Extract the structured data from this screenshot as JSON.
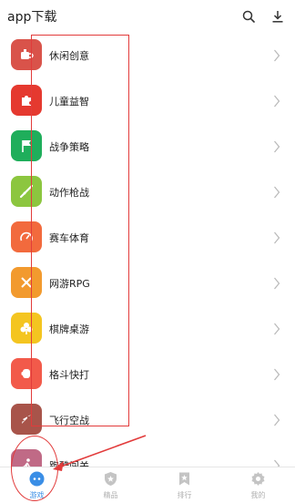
{
  "header": {
    "title": "app下载",
    "search_icon": "search-icon",
    "download_icon": "download-icon"
  },
  "categories": [
    {
      "label": "休闲创意",
      "icon": "puzzle-cup-icon",
      "color": "#d9534a"
    },
    {
      "label": "儿童益智",
      "icon": "puzzle-piece-icon",
      "color": "#e5392f"
    },
    {
      "label": "战争策略",
      "icon": "flag-icon",
      "color": "#1fae5b"
    },
    {
      "label": "动作枪战",
      "icon": "rifle-icon",
      "color": "#8cc63f"
    },
    {
      "label": "赛车体育",
      "icon": "speedometer-icon",
      "color": "#f26a3d"
    },
    {
      "label": "网游RPG",
      "icon": "crossed-swords-icon",
      "color": "#f29a2e"
    },
    {
      "label": "棋牌桌游",
      "icon": "club-card-icon",
      "color": "#f4c520"
    },
    {
      "label": "格斗快打",
      "icon": "fist-icon",
      "color": "#f25a4a"
    },
    {
      "label": "飞行空战",
      "icon": "rocket-icon",
      "color": "#a8544a"
    },
    {
      "label": "跑酷闯关",
      "icon": "runner-icon",
      "color": "#c06a86"
    }
  ],
  "tabbar": {
    "tabs": [
      {
        "label": "游戏",
        "icon": "gamepad-icon",
        "active": true
      },
      {
        "label": "精品",
        "icon": "shield-star-icon",
        "active": false
      },
      {
        "label": "排行",
        "icon": "bookmark-icon",
        "active": false
      },
      {
        "label": "我的",
        "icon": "gear-icon",
        "active": false
      }
    ]
  },
  "colors": {
    "accent": "#3a8ee6",
    "annotation": "#e23b3b"
  }
}
